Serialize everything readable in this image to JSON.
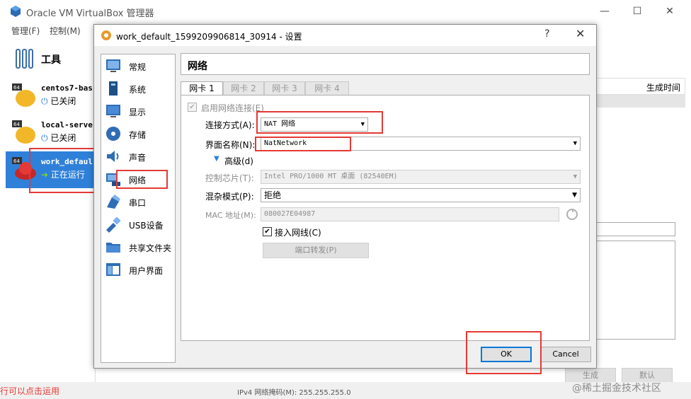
{
  "main_window": {
    "title": "Oracle VM VirtualBox 管理器",
    "menu": [
      "管理(F)",
      "控制(M)"
    ],
    "tools_label": "工具",
    "vms": [
      {
        "name": "centos7-bas",
        "status": "已关闭"
      },
      {
        "name": "local-serve",
        "status": "已关闭"
      },
      {
        "name": "work_defaul",
        "status": "正在运行"
      }
    ],
    "right_column_header": "生成时间",
    "bottom_buttons": [
      "生成",
      "默认"
    ],
    "bottom_text_left": "行可以点击运用",
    "bottom_text_mid": "IPv4 网络掩码(M):  255.255.255.0",
    "watermark": "@稀土掘金技术社区"
  },
  "dialog": {
    "title": "work_default_1599209906814_30914 - 设置",
    "help": "?",
    "close": "✕",
    "categories": [
      {
        "label": "常规",
        "icon": "general-icon"
      },
      {
        "label": "系统",
        "icon": "system-icon"
      },
      {
        "label": "显示",
        "icon": "display-icon"
      },
      {
        "label": "存储",
        "icon": "storage-icon"
      },
      {
        "label": "声音",
        "icon": "audio-icon"
      },
      {
        "label": "网络",
        "icon": "network-icon"
      },
      {
        "label": "串口",
        "icon": "serial-port-icon"
      },
      {
        "label": "USB设备",
        "icon": "usb-icon"
      },
      {
        "label": "共享文件夹",
        "icon": "shared-folder-icon"
      },
      {
        "label": "用户界面",
        "icon": "user-interface-icon"
      }
    ],
    "section_title": "网络",
    "tabs": [
      "网卡 1",
      "网卡 2",
      "网卡 3",
      "网卡 4"
    ],
    "adapter": {
      "enable_label": "启用网络连接(E)",
      "enable_checked": true,
      "attach_label": "连接方式(A):",
      "attach_value": "NAT 网络",
      "name_label": "界面名称(N):",
      "name_value": "NatNetwork",
      "advanced_label": "高级(d)",
      "chip_label": "控制芯片(T):",
      "chip_value": "Intel PRO/1000 MT 桌面 (82540EM)",
      "promisc_label": "混杂模式(P):",
      "promisc_value": "拒绝",
      "mac_label": "MAC 地址(M):",
      "mac_value": "080027E04987",
      "cable_label": "接入网线(C)",
      "cable_checked": true,
      "port_forward_label": "端口转发(P)"
    },
    "ok_label": "OK",
    "cancel_label": "Cancel"
  },
  "colors": {
    "selection": "#2f80d9",
    "annotation": "#e53935",
    "default_button": "#0078d7"
  }
}
